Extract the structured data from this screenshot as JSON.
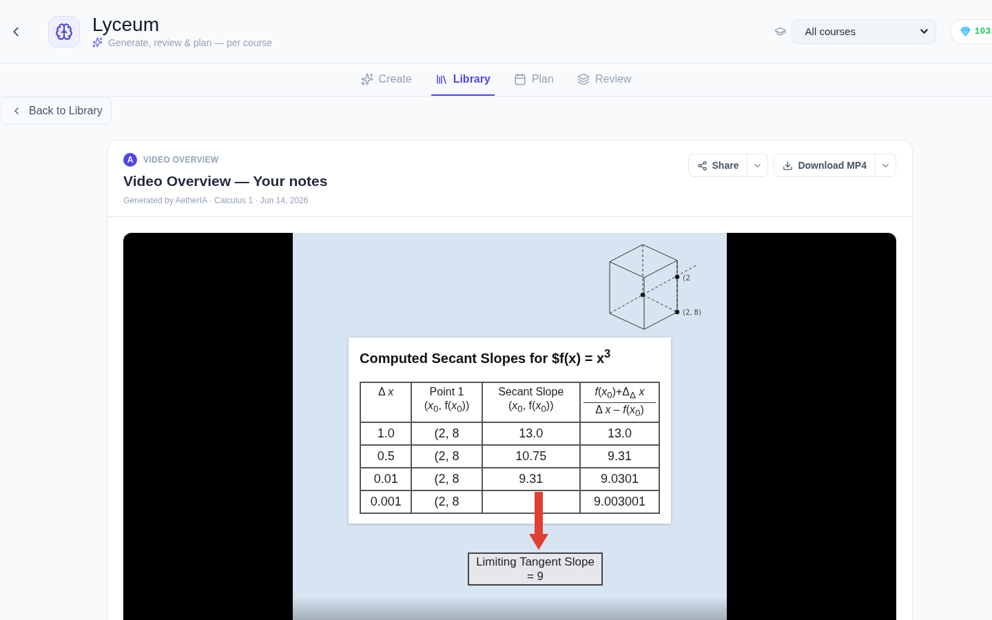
{
  "app": {
    "title": "Lyceum",
    "subtitle": "Generate, review & plan — per course"
  },
  "course_select": {
    "value": "All courses"
  },
  "credits": "103",
  "tabs": [
    {
      "label": "Create",
      "selected": false
    },
    {
      "label": "Library",
      "selected": true
    },
    {
      "label": "Plan",
      "selected": false
    },
    {
      "label": "Review",
      "selected": false
    }
  ],
  "back_button": "Back to Library",
  "card": {
    "badge": "A",
    "eyebrow": "VIDEO OVERVIEW",
    "title": "Video Overview — Your notes",
    "meta": "Generated by AetherIA · Calculus 1 · Jun 14, 2026",
    "actions": [
      {
        "label": "Share"
      },
      {
        "label": "Download MP4"
      }
    ]
  },
  "video": {
    "slide": {
      "title": "Computed Secant Slopes for $f(x) = x$^{3}$",
      "figure_labels": [
        "(2",
        "(2, 8)"
      ],
      "table": {
        "columns": [
          {
            "kind": "single",
            "lines": [
              "Δ *x*"
            ]
          },
          {
            "kind": "stacked",
            "lines": [
              "Point 1",
              "(*x*$_{0}$, f(*x*$_{0}$))"
            ]
          },
          {
            "kind": "stacked",
            "lines": [
              "Secant Slope",
              "(*x*$_{0}$, f(*x*$_{0}$))"
            ]
          },
          {
            "kind": "fraction",
            "lines": [
              "*f*(*x*$_{0}$)+Δ$_{Δ}$ *x*",
              "Δ *x* – *f*(*x*$_{0}$)"
            ]
          }
        ],
        "rows": [
          [
            "1.0",
            "(2, 8",
            "13.0",
            "13.0"
          ],
          [
            "0.5",
            "(2, 8",
            "10.75",
            "9.31"
          ],
          [
            "0.01",
            "(2, 8",
            "9.31",
            "9.0301"
          ],
          [
            "0.001",
            "(2, 8",
            null,
            "9.003001"
          ]
        ]
      },
      "result": [
        "Limiting Tangent Slope",
        "= 9"
      ]
    }
  }
}
